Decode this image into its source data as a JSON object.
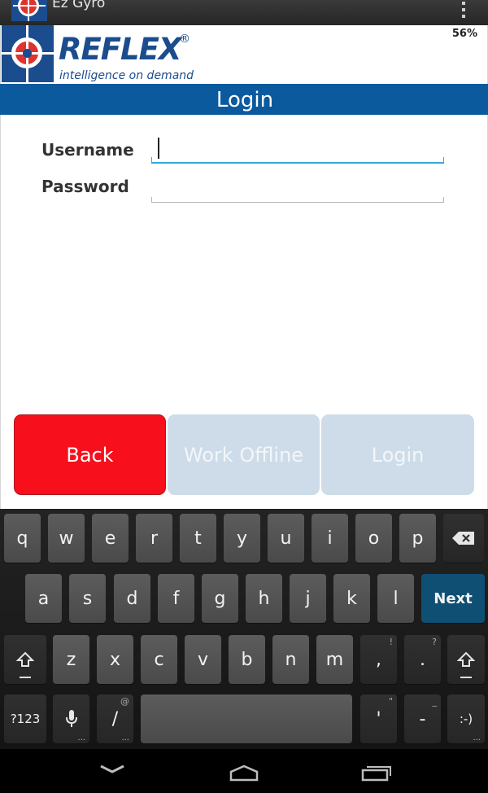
{
  "app": {
    "title": "Ez Gyro",
    "battery": "56%"
  },
  "header": {
    "brand": "REFLEX",
    "registered": "®",
    "tagline": "intelligence on demand",
    "title": "Login"
  },
  "form": {
    "username_label": "Username",
    "password_label": "Password",
    "username_value": "",
    "password_value": ""
  },
  "buttons": {
    "back": "Back",
    "offline": "Work Offline",
    "login": "Login"
  },
  "colors": {
    "brand_blue": "#1b4c8e",
    "title_bar": "#0c5a9e",
    "back_button": "#f70f1b",
    "disabled_button": "#cddce8",
    "focus_underline": "#33aadc",
    "next_key": "#0f4f74"
  },
  "keyboard": {
    "row1": [
      "q",
      "w",
      "e",
      "r",
      "t",
      "y",
      "u",
      "i",
      "o",
      "p"
    ],
    "row2": [
      "a",
      "s",
      "d",
      "f",
      "g",
      "h",
      "j",
      "k",
      "l"
    ],
    "row3": [
      "z",
      "x",
      "c",
      "v",
      "b",
      "n",
      "m",
      ",",
      "."
    ],
    "row3_hints": {
      "comma": "!",
      "period": "?"
    },
    "next": "Next",
    "symbols": "?123",
    "slash": "/",
    "slash_hint": "@",
    "apostrophe": "'",
    "apostrophe_hint": "\"",
    "dash": "-",
    "dash_hint": "_",
    "smiley": ":-)"
  },
  "icons": [
    "app-logo-icon",
    "overflow-menu-icon",
    "backspace-icon",
    "shift-icon",
    "mic-icon",
    "back-nav-icon",
    "home-nav-icon",
    "recents-nav-icon"
  ]
}
